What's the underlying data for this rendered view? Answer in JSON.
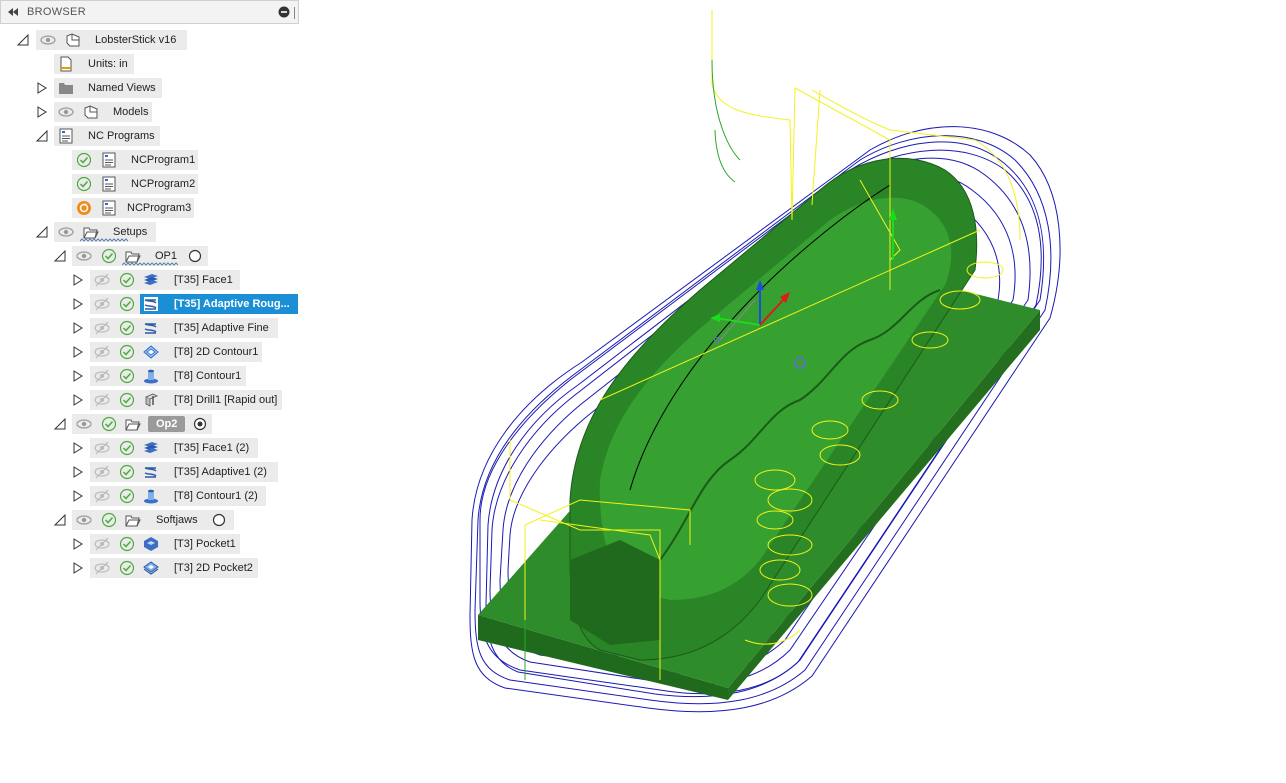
{
  "browser": {
    "title": "BROWSER",
    "root": {
      "label": "LobsterStick v16"
    },
    "units": {
      "label": "Units: in"
    },
    "named_views": {
      "label": "Named Views"
    },
    "models": {
      "label": "Models"
    },
    "nc_programs": {
      "label": "NC Programs",
      "items": [
        {
          "label": "NCProgram1",
          "status": "ok"
        },
        {
          "label": "NCProgram2",
          "status": "ok"
        },
        {
          "label": "NCProgram3",
          "status": "pending"
        }
      ]
    },
    "setups": {
      "label": "Setups",
      "groups": [
        {
          "label": "OP1",
          "radio": "unselected",
          "ops": [
            {
              "label": "[T35] Face1",
              "icon": "face-icon"
            },
            {
              "label": "[T35] Adaptive Roug...",
              "icon": "adaptive-icon",
              "selected": true
            },
            {
              "label": "[T35] Adaptive Fine",
              "icon": "adaptive-icon"
            },
            {
              "label": "[T8] 2D Contour1",
              "icon": "contour-2d-icon"
            },
            {
              "label": "[T8] Contour1",
              "icon": "contour-icon"
            },
            {
              "label": "[T8] Drill1 [Rapid out]",
              "icon": "drill-icon"
            }
          ]
        },
        {
          "label": "Op2",
          "radio": "selected",
          "ops": [
            {
              "label": "[T35] Face1 (2)",
              "icon": "face-icon"
            },
            {
              "label": "[T35] Adaptive1 (2)",
              "icon": "adaptive-icon"
            },
            {
              "label": "[T8] Contour1 (2)",
              "icon": "contour-icon"
            }
          ]
        },
        {
          "label": "Softjaws",
          "radio": "unselected",
          "ops": [
            {
              "label": "[T3] Pocket1",
              "icon": "pocket-icon"
            },
            {
              "label": "[T3] 2D Pocket2",
              "icon": "pocket-2d-icon"
            }
          ]
        }
      ]
    }
  },
  "colors": {
    "selection": "#1b8fd6",
    "check": "#4caa3c",
    "pending": "#f08c1a",
    "stock_green": "#2f8c2a",
    "toolpath_blue": "#1a1ab4",
    "toolpath_yellow": "#f2f21a"
  }
}
